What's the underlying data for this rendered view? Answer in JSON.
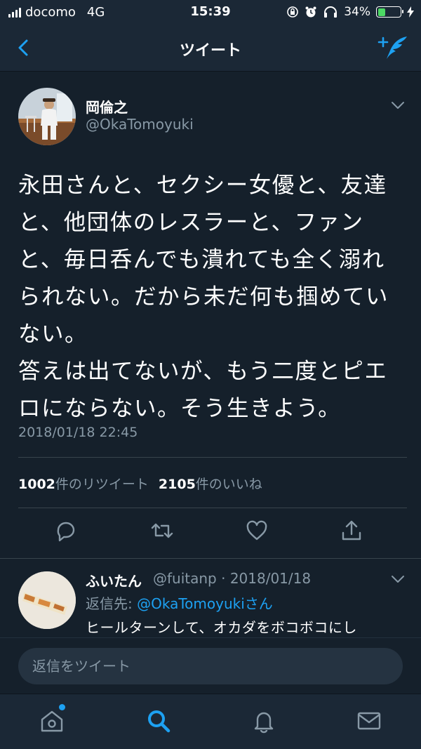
{
  "status_bar": {
    "carrier": "docomo",
    "network": "4G",
    "time": "15:39",
    "battery_percent_label": "34%",
    "battery_level": 0.34
  },
  "nav": {
    "title": "ツイート"
  },
  "tweet": {
    "display_name": "岡倫之",
    "handle": "@OkaTomoyuki",
    "body": "永田さんと、セクシー女優と、友達と、他団体のレスラーと、ファンと、毎日呑んでも潰れても全く溺れられない。だから未だ何も掴めていない。\n答えは出てないが、もう二度とピエロにならない。そう生きよう。",
    "timestamp": "2018/01/18 22:45",
    "retweet_count": "1002",
    "retweet_label": "件のリツイート",
    "like_count": "2105",
    "like_label": "件のいいね"
  },
  "reply": {
    "display_name": "ふいたん",
    "meta": "@fuitanp · 2018/01/18",
    "reply_to_prefix": "返信先: ",
    "reply_to_handle": "@OkaTomoyukiさん",
    "text": "ヒールターンして、オカダをボコボコにし"
  },
  "composer": {
    "placeholder": "返信をツイート"
  },
  "colors": {
    "background": "#15202b",
    "bar": "#1b2836",
    "accent": "#1da1f2",
    "secondary_text": "#8899a6",
    "divider": "#38444d"
  },
  "icons": {
    "back": "chevron-left-icon",
    "compose": "compose-tweet-icon",
    "more": "chevron-down-icon",
    "reply": "reply-icon",
    "retweet": "retweet-icon",
    "like": "heart-icon",
    "share": "share-icon",
    "home": "home-icon",
    "search": "search-icon",
    "notifications": "bell-icon",
    "messages": "envelope-icon"
  }
}
